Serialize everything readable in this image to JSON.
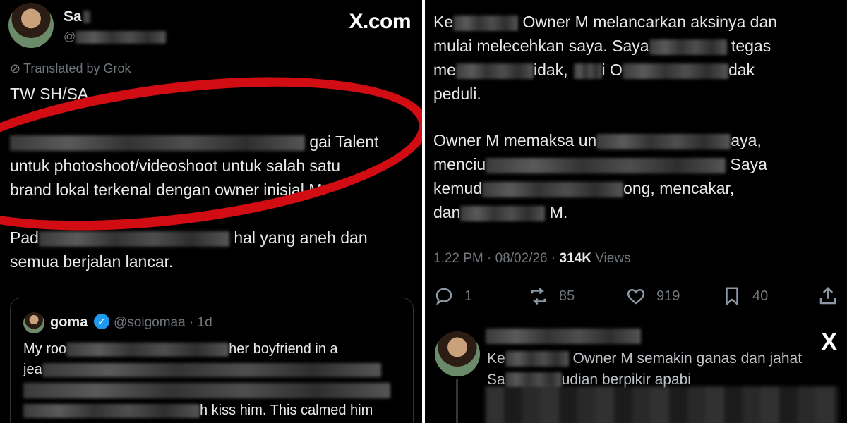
{
  "left_post": {
    "author_name": "Sa",
    "site_logo": "X.com",
    "translated_label": "Translated by Grok",
    "tw_line": "TW SH/SA",
    "para1": [
      {
        "pre": "",
        "post": "gai Talent"
      },
      {
        "pre": "untuk photoshoot/videoshoot untuk salah satu",
        "post": ""
      },
      {
        "pre": "brand lokal terkenal dengan owner inisial M.",
        "post": ""
      }
    ],
    "para2": [
      {
        "pre": "Pad",
        "post": "hal yang aneh dan"
      },
      {
        "pre": "semua berjalan lancar.",
        "post": ""
      }
    ]
  },
  "quoted_post": {
    "name": "goma",
    "handle": "@soigomaa · 1d",
    "line1_pre": "My roo",
    "line1_post": "her boyfriend in a",
    "line2_pre": "jea",
    "line4_post": "h kiss him. This calmed him"
  },
  "right_post": {
    "para1": [
      {
        "pre": "Ke",
        "post": "Owner M melancarkan aksinya dan"
      },
      {
        "pre": "mulai melecehkan saya. Saya",
        "post": "tegas"
      },
      {
        "pre": "me",
        "post": "idak,",
        "tail": "i O",
        "end": "dak"
      },
      {
        "pre": "peduli.",
        "post": ""
      }
    ],
    "para2": [
      {
        "pre": "Owner M memaksa un",
        "post": "aya,"
      },
      {
        "pre": "menciu",
        "post": "Saya"
      },
      {
        "pre": "kemud",
        "post": "ong, mencakar,"
      },
      {
        "pre": "dan",
        "post": "M."
      }
    ],
    "time": "1.22 PM · 08/02/26 · ",
    "views_count": "314K",
    "views_label": " Views",
    "replies": "1",
    "reposts": "85",
    "likes": "919",
    "bookmarks": "40"
  },
  "reply_post": {
    "line1_pre": "Ke",
    "line1_post": "Owner M semakin ganas dan jahat",
    "line2_pre": "Sa",
    "line2_post": "udian berpikir apabi",
    "x_logo": "X"
  }
}
